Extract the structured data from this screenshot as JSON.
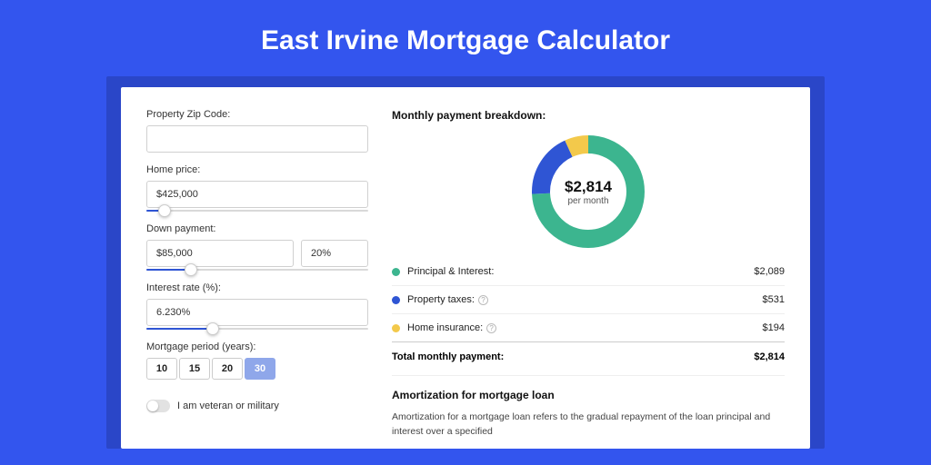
{
  "title": "East Irvine Mortgage Calculator",
  "labels": {
    "zip": "Property Zip Code:",
    "homePrice": "Home price:",
    "downPayment": "Down payment:",
    "interestRate": "Interest rate (%):",
    "period": "Mortgage period (years):",
    "veteran": "I am veteran or military"
  },
  "values": {
    "zip": "",
    "homePrice": "$425,000",
    "downPaymentAmt": "$85,000",
    "downPaymentPct": "20%",
    "interestRate": "6.230%"
  },
  "periods": {
    "options": [
      "10",
      "15",
      "20",
      "30"
    ],
    "active": "30"
  },
  "sliders": {
    "homePricePct": 8,
    "downPaymentPct": 20,
    "interestPct": 30
  },
  "breakdown": {
    "title": "Monthly payment breakdown:",
    "center": "$2,814",
    "centerSub": "per month",
    "items": [
      {
        "label": "Principal & Interest:",
        "value": "$2,089",
        "color": "#3cb58f",
        "num": 2089
      },
      {
        "label": "Property taxes:",
        "value": "$531",
        "color": "#2f55d4",
        "num": 531,
        "help": true
      },
      {
        "label": "Home insurance:",
        "value": "$194",
        "color": "#f3c94b",
        "num": 194,
        "help": true
      }
    ],
    "totalLabel": "Total monthly payment:",
    "totalValue": "$2,814"
  },
  "chart_data": {
    "type": "pie",
    "title": "Monthly payment breakdown",
    "categories": [
      "Principal & Interest",
      "Property taxes",
      "Home insurance"
    ],
    "values": [
      2089,
      531,
      194
    ],
    "colors": [
      "#3cb58f",
      "#2f55d4",
      "#f3c94b"
    ],
    "total": 2814,
    "center_label": "$2,814 per month"
  },
  "amort": {
    "title": "Amortization for mortgage loan",
    "text": "Amortization for a mortgage loan refers to the gradual repayment of the loan principal and interest over a specified"
  }
}
